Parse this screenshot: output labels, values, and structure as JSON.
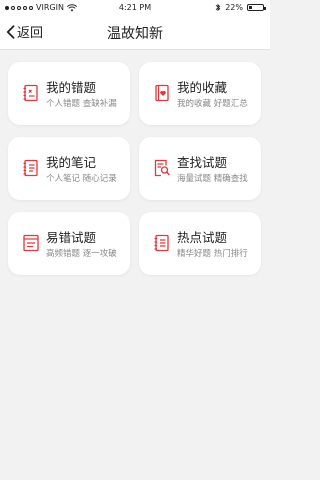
{
  "status_bar": {
    "carrier": "VIRGIN",
    "time": "4:21 PM",
    "battery_text": "22%",
    "battery_level": 0.22
  },
  "nav": {
    "back_label": "返回",
    "title": "温故知新"
  },
  "accent_color": "#e8343a",
  "cards": [
    {
      "title": "我的错题",
      "sub": "个人错题  查缺补漏",
      "icon": "error-notebook-icon"
    },
    {
      "title": "我的收藏",
      "sub": "我的收藏  好题汇总",
      "icon": "favorites-book-icon"
    },
    {
      "title": "我的笔记",
      "sub": "个人笔记  随心记录",
      "icon": "notes-icon"
    },
    {
      "title": "查找试题",
      "sub": "海量试题  精确查找",
      "icon": "search-document-icon"
    },
    {
      "title": "易错试题",
      "sub": "高频错题  逐一攻破",
      "icon": "frequent-errors-icon"
    },
    {
      "title": "热点试题",
      "sub": "精华好题  热门排行",
      "icon": "hot-questions-icon"
    }
  ]
}
